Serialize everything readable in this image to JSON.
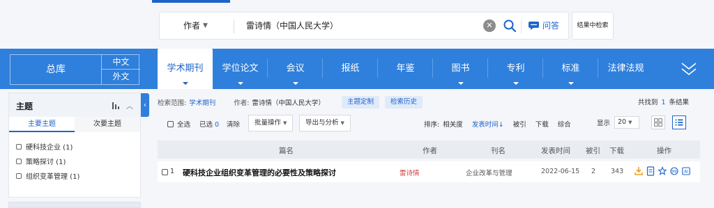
{
  "search": {
    "field_label": "作者",
    "query": "雷诗情（中国人民大学）",
    "qa_label": "问答",
    "within_label": "结果中检索"
  },
  "nav": {
    "db_all": "总库",
    "lang_zh": "中文",
    "lang_wai": "外文",
    "tabs": [
      {
        "label": "学术期刊"
      },
      {
        "label": "学位论文"
      },
      {
        "label": "会议"
      },
      {
        "label": "报纸"
      },
      {
        "label": "年鉴"
      },
      {
        "label": "图书"
      },
      {
        "label": "专利"
      },
      {
        "label": "标准"
      },
      {
        "label": "法律法规"
      }
    ]
  },
  "sidebar": {
    "title": "主题",
    "tab_main": "主要主题",
    "tab_secondary": "次要主题",
    "items": [
      {
        "label": "硬科技企业 (1)"
      },
      {
        "label": "策略探讨 (1)"
      },
      {
        "label": "组织变革管理 (1)"
      }
    ]
  },
  "scope": {
    "label": "检索范围:",
    "value": "学术期刊",
    "author_label": "作者:",
    "author_value": "雷诗情（中国人民大学）",
    "topic_btn": "主题定制",
    "history_btn": "检索历史",
    "found_prefix": "共找到",
    "found_count": "1",
    "found_suffix": "条结果"
  },
  "toolbar": {
    "select_all": "全选",
    "selected_label": "已选",
    "selected_count": "0",
    "clear": "清除",
    "batch": "批量操作",
    "export": "导出与分析",
    "sort_label": "排序:",
    "sort_relevance": "相关度",
    "sort_date": "发表时间↓",
    "sort_cited": "被引",
    "sort_download": "下载",
    "sort_composite": "综合",
    "show_label": "显示",
    "show_value": "20"
  },
  "table": {
    "headers": {
      "title": "篇名",
      "author": "作者",
      "journal": "刊名",
      "date": "发表时间",
      "cited": "被引",
      "downloads": "下载",
      "ops": "操作"
    },
    "rows": [
      {
        "index": "1",
        "title": "硬科技企业组织变革管理的必要性及策略探讨",
        "author": "雷诗情",
        "journal": "企业改革与管理",
        "date": "2022-06-15",
        "cited": "2",
        "downloads": "343"
      }
    ]
  },
  "colors": {
    "brand_blue": "#2f7fdc",
    "link_blue": "#1e64c8",
    "author_red": "#d43c3c",
    "download_orange": "#f0a020"
  }
}
